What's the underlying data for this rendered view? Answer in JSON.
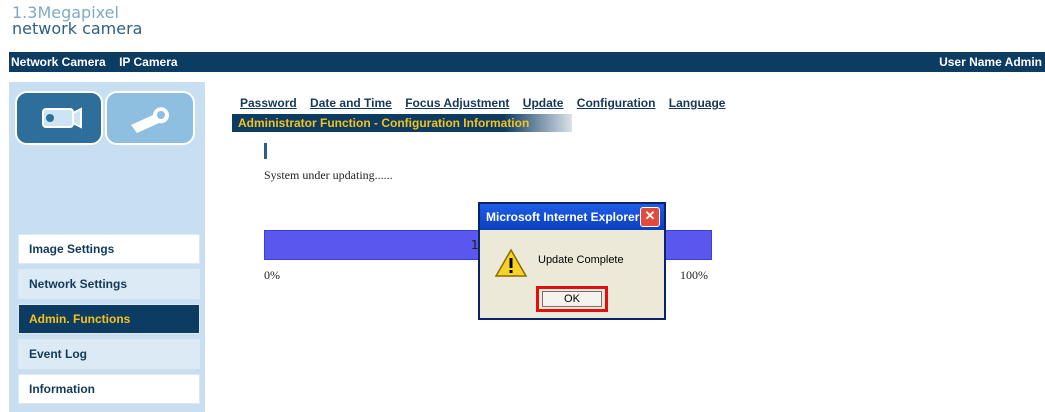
{
  "logo": {
    "line1": "1.3Megapixel",
    "line2": "network camera"
  },
  "topbar": {
    "left1": "Network Camera",
    "left2": "IP Camera",
    "right": "User Name Admin"
  },
  "sidebar": {
    "tabs": [
      {
        "name": "camera-icon"
      },
      {
        "name": "wrench-icon"
      }
    ],
    "items": [
      {
        "label": "Image Settings",
        "state": "normal"
      },
      {
        "label": "Network Settings",
        "state": "light"
      },
      {
        "label": "Admin. Functions",
        "state": "active"
      },
      {
        "label": "Event Log",
        "state": "light"
      },
      {
        "label": "Information",
        "state": "normal"
      }
    ]
  },
  "main": {
    "tabs": [
      "Password",
      "Date and Time",
      "Focus Adjustment",
      "Update",
      "Configuration",
      "Language"
    ],
    "heading": "Administrator Function - Configuration Information",
    "status": "System under updating......",
    "progress": {
      "percent_text": "1(",
      "start": "0%",
      "end": "100%",
      "fraction": 1.0
    }
  },
  "dialog": {
    "title": "Microsoft Internet Explorer",
    "message": "Update Complete",
    "ok": "OK",
    "close": "✕"
  },
  "colors": {
    "brand": "#0d3c63",
    "accent": "#f6c21a",
    "progress": "#5a57ef",
    "highlight": "#e01010"
  }
}
